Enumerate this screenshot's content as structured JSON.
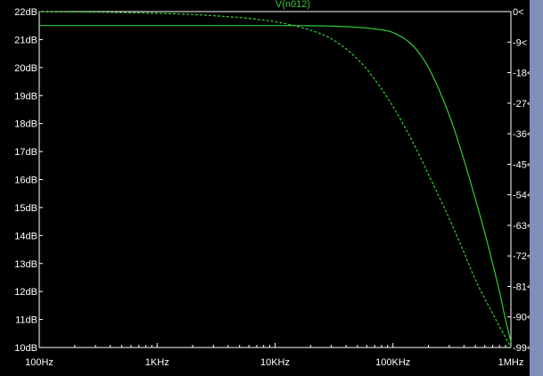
{
  "chart_data": {
    "type": "line",
    "title": "V(n012)",
    "x_scale": "log",
    "xlim": [
      100,
      1000000
    ],
    "x_ticks": [
      {
        "value": 100,
        "label": "100Hz"
      },
      {
        "value": 1000,
        "label": "1KHz"
      },
      {
        "value": 10000,
        "label": "10KHz"
      },
      {
        "value": 100000,
        "label": "100KHz"
      },
      {
        "value": 1000000,
        "label": "1MHz"
      }
    ],
    "ylim_left": [
      10,
      22
    ],
    "y_ticks_left": [
      "10dB",
      "11dB",
      "12dB",
      "13dB",
      "14dB",
      "15dB",
      "16dB",
      "17dB",
      "18dB",
      "19dB",
      "20dB",
      "21dB",
      "22dB"
    ],
    "ylim_right": [
      -99,
      0
    ],
    "y_ticks_right": [
      "-99<",
      "-90<",
      "-81<",
      "-72<",
      "-63<",
      "-54<",
      "-45<",
      "-36<",
      "-27<",
      "-18<",
      "-9<",
      "0<"
    ],
    "grid": false,
    "series": [
      {
        "axis": "left",
        "style": "solid",
        "x": [
          100,
          1000,
          10000,
          30000,
          50000,
          70000,
          100000,
          150000,
          200000,
          300000,
          400000,
          500000,
          600000,
          700000,
          800000,
          900000,
          1000000
        ],
        "y": [
          21.5,
          21.5,
          21.5,
          21.48,
          21.44,
          21.38,
          21.25,
          20.75,
          20.0,
          18.3,
          16.7,
          15.3,
          14.1,
          13.0,
          12.0,
          11.0,
          10.2
        ]
      },
      {
        "axis": "right",
        "style": "dashed",
        "x": [
          100,
          1000,
          3000,
          10000,
          20000,
          30000,
          50000,
          70000,
          100000,
          150000,
          200000,
          300000,
          400000,
          500000,
          700000,
          1000000
        ],
        "y": [
          0,
          -0.5,
          -1.2,
          -3,
          -5.5,
          -8,
          -14,
          -20,
          -28,
          -39,
          -48,
          -61,
          -71,
          -79,
          -89,
          -99
        ]
      }
    ]
  },
  "colors": {
    "trace": "#33cc33",
    "axis": "#ffffff",
    "background": "#000000",
    "scrollbar": "#7f8fb8"
  }
}
